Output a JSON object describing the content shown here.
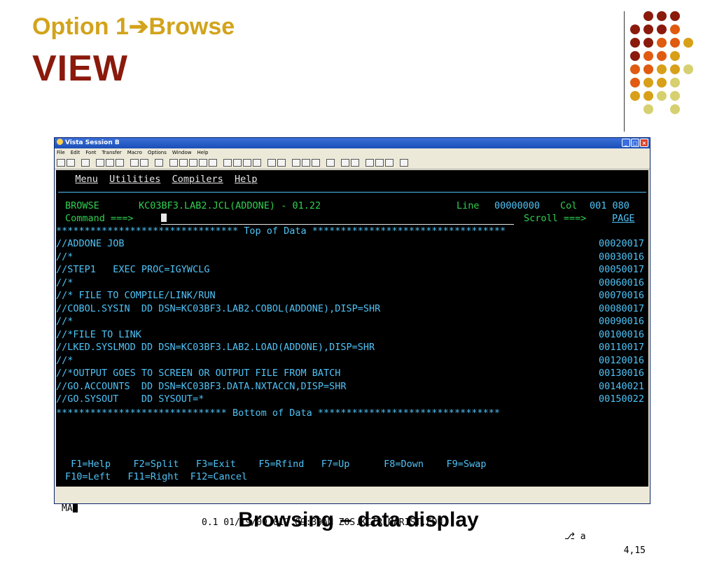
{
  "slide": {
    "title": "Option 1➔Browse",
    "subtitle": "VIEW",
    "caption": "Browsing – data display"
  },
  "window": {
    "title": "Vista Session B",
    "menu": [
      "File",
      "Edit",
      "Font",
      "Transfer",
      "Macro",
      "Options",
      "Window",
      "Help"
    ]
  },
  "terminal": {
    "menu": [
      "Menu",
      "Utilities",
      "Compilers",
      "Help"
    ],
    "mode": "BROWSE",
    "dataset": "KC03BF3.LAB2.JCL(ADDONE) - 01.22",
    "line_label": "Line",
    "line_value": "00000000",
    "col_label": "Col",
    "col_value": "001 080",
    "command_label": "Command ===>",
    "command_value": "",
    "scroll_label": "Scroll ===>",
    "scroll_value": "PAGE",
    "top_banner": "******************************** Top of Data **********************************",
    "bottom_banner": "****************************** Bottom of Data ********************************",
    "lines": [
      {
        "text": "//ADDONE JOB",
        "num": "00020017"
      },
      {
        "text": "//*",
        "num": "00030016"
      },
      {
        "text": "//STEP1   EXEC PROC=IGYWCLG",
        "num": "00050017"
      },
      {
        "text": "//*",
        "num": "00060016"
      },
      {
        "text": "//* FILE TO COMPILE/LINK/RUN",
        "num": "00070016"
      },
      {
        "text": "//COBOL.SYSIN  DD DSN=KC03BF3.LAB2.COBOL(ADDONE),DISP=SHR",
        "num": "00080017"
      },
      {
        "text": "//*",
        "num": "00090016"
      },
      {
        "text": "//*FILE TO LINK",
        "num": "00100016"
      },
      {
        "text": "//LKED.SYSLMOD DD DSN=KC03BF3.LAB2.LOAD(ADDONE),DISP=SHR",
        "num": "00110017"
      },
      {
        "text": "//*",
        "num": "00120016"
      },
      {
        "text": "//*OUTPUT GOES TO SCREEN OR OUTPUT FILE FROM BATCH",
        "num": "00130016"
      },
      {
        "text": "//GO.ACCOUNTS  DD DSN=KC03BF3.DATA.NXTACCN,DISP=SHR",
        "num": "00140021"
      },
      {
        "text": "//GO.SYSOUT    DD SYSOUT=*",
        "num": "00150022"
      }
    ],
    "fkeys_row1": " F1=Help    F2=Split   F3=Exit    F5=Rfind   F7=Up      F8=Down    F9=Swap",
    "fkeys_row2": "F10=Left   F11=Right  F12=Cancel"
  },
  "status": {
    "ma": "MA",
    "info": "0.1 01/19/09.019 09:39AM ZOS.KCTR.MARIST.EDU",
    "mode": "⎇ a",
    "position": "4,15"
  },
  "colors": {
    "title_gold": "#d2a31b",
    "subtitle_red": "#8b1a0c",
    "term_cyan": "#4fc3f7",
    "term_green": "#30d050",
    "term_yellow": "#e0d020"
  }
}
